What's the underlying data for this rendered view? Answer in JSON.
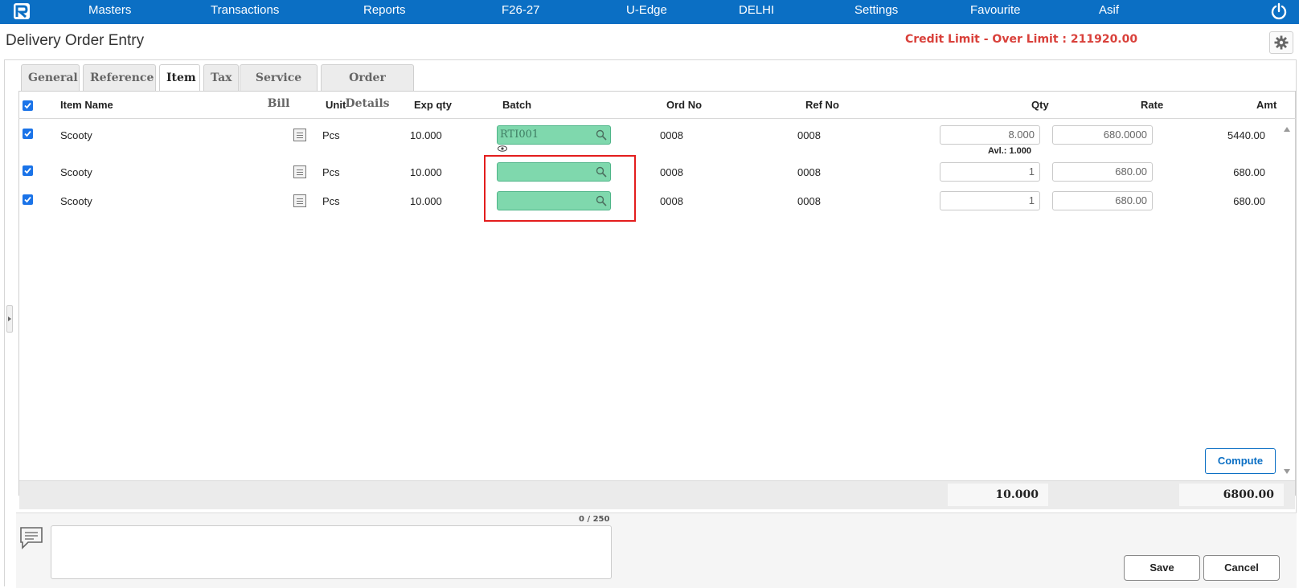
{
  "topnav": {
    "items": [
      "Masters",
      "Transactions",
      "Reports",
      "F26-27",
      "U-Edge",
      "DELHI",
      "Settings",
      "Favourite",
      "Asif"
    ],
    "bg_color": "#0b6fc4",
    "logo_icon": "app-logo-icon",
    "power_icon": "power-icon"
  },
  "header": {
    "title": "Delivery Order Entry",
    "credit_notice": "Credit Limit - Over Limit : 211920.00",
    "credit_color": "#d9413b",
    "settings_icon": "gear-icon"
  },
  "tabs": [
    {
      "label": "General",
      "active": false
    },
    {
      "label": "Reference",
      "active": false
    },
    {
      "label": "Item",
      "active": true
    },
    {
      "label": "Tax",
      "active": false
    },
    {
      "label": "Service Bill",
      "active": false
    },
    {
      "label": "Order Details",
      "active": false
    }
  ],
  "grid": {
    "columns": {
      "item_name": "Item Name",
      "unit": "Unit",
      "exp_qty": "Exp qty",
      "batch": "Batch",
      "ord_no": "Ord No",
      "ref_no": "Ref No",
      "qty": "Qty",
      "rate": "Rate",
      "amt": "Amt"
    },
    "rows": [
      {
        "item_name": "Scooty",
        "unit": "Pcs",
        "exp_qty": "10.000",
        "batch": "RTI001",
        "ord_no": "0008",
        "ref_no": "0008",
        "qty": "8.000",
        "rate": "680.0000",
        "amt": "5440.00",
        "avl": "Avl.: 1.000"
      },
      {
        "item_name": "Scooty",
        "unit": "Pcs",
        "exp_qty": "10.000",
        "batch": "",
        "ord_no": "0008",
        "ref_no": "0008",
        "qty": "1",
        "rate": "680.00",
        "amt": "680.00"
      },
      {
        "item_name": "Scooty",
        "unit": "Pcs",
        "exp_qty": "10.000",
        "batch": "",
        "ord_no": "0008",
        "ref_no": "0008",
        "qty": "1",
        "rate": "680.00",
        "amt": "680.00"
      }
    ],
    "compute_label": "Compute",
    "total_qty": "10.000",
    "total_amt": "6800.00"
  },
  "remarks": {
    "counter": "0 / 250",
    "value": ""
  },
  "actions": {
    "save_label": "Save",
    "cancel_label": "Cancel"
  }
}
